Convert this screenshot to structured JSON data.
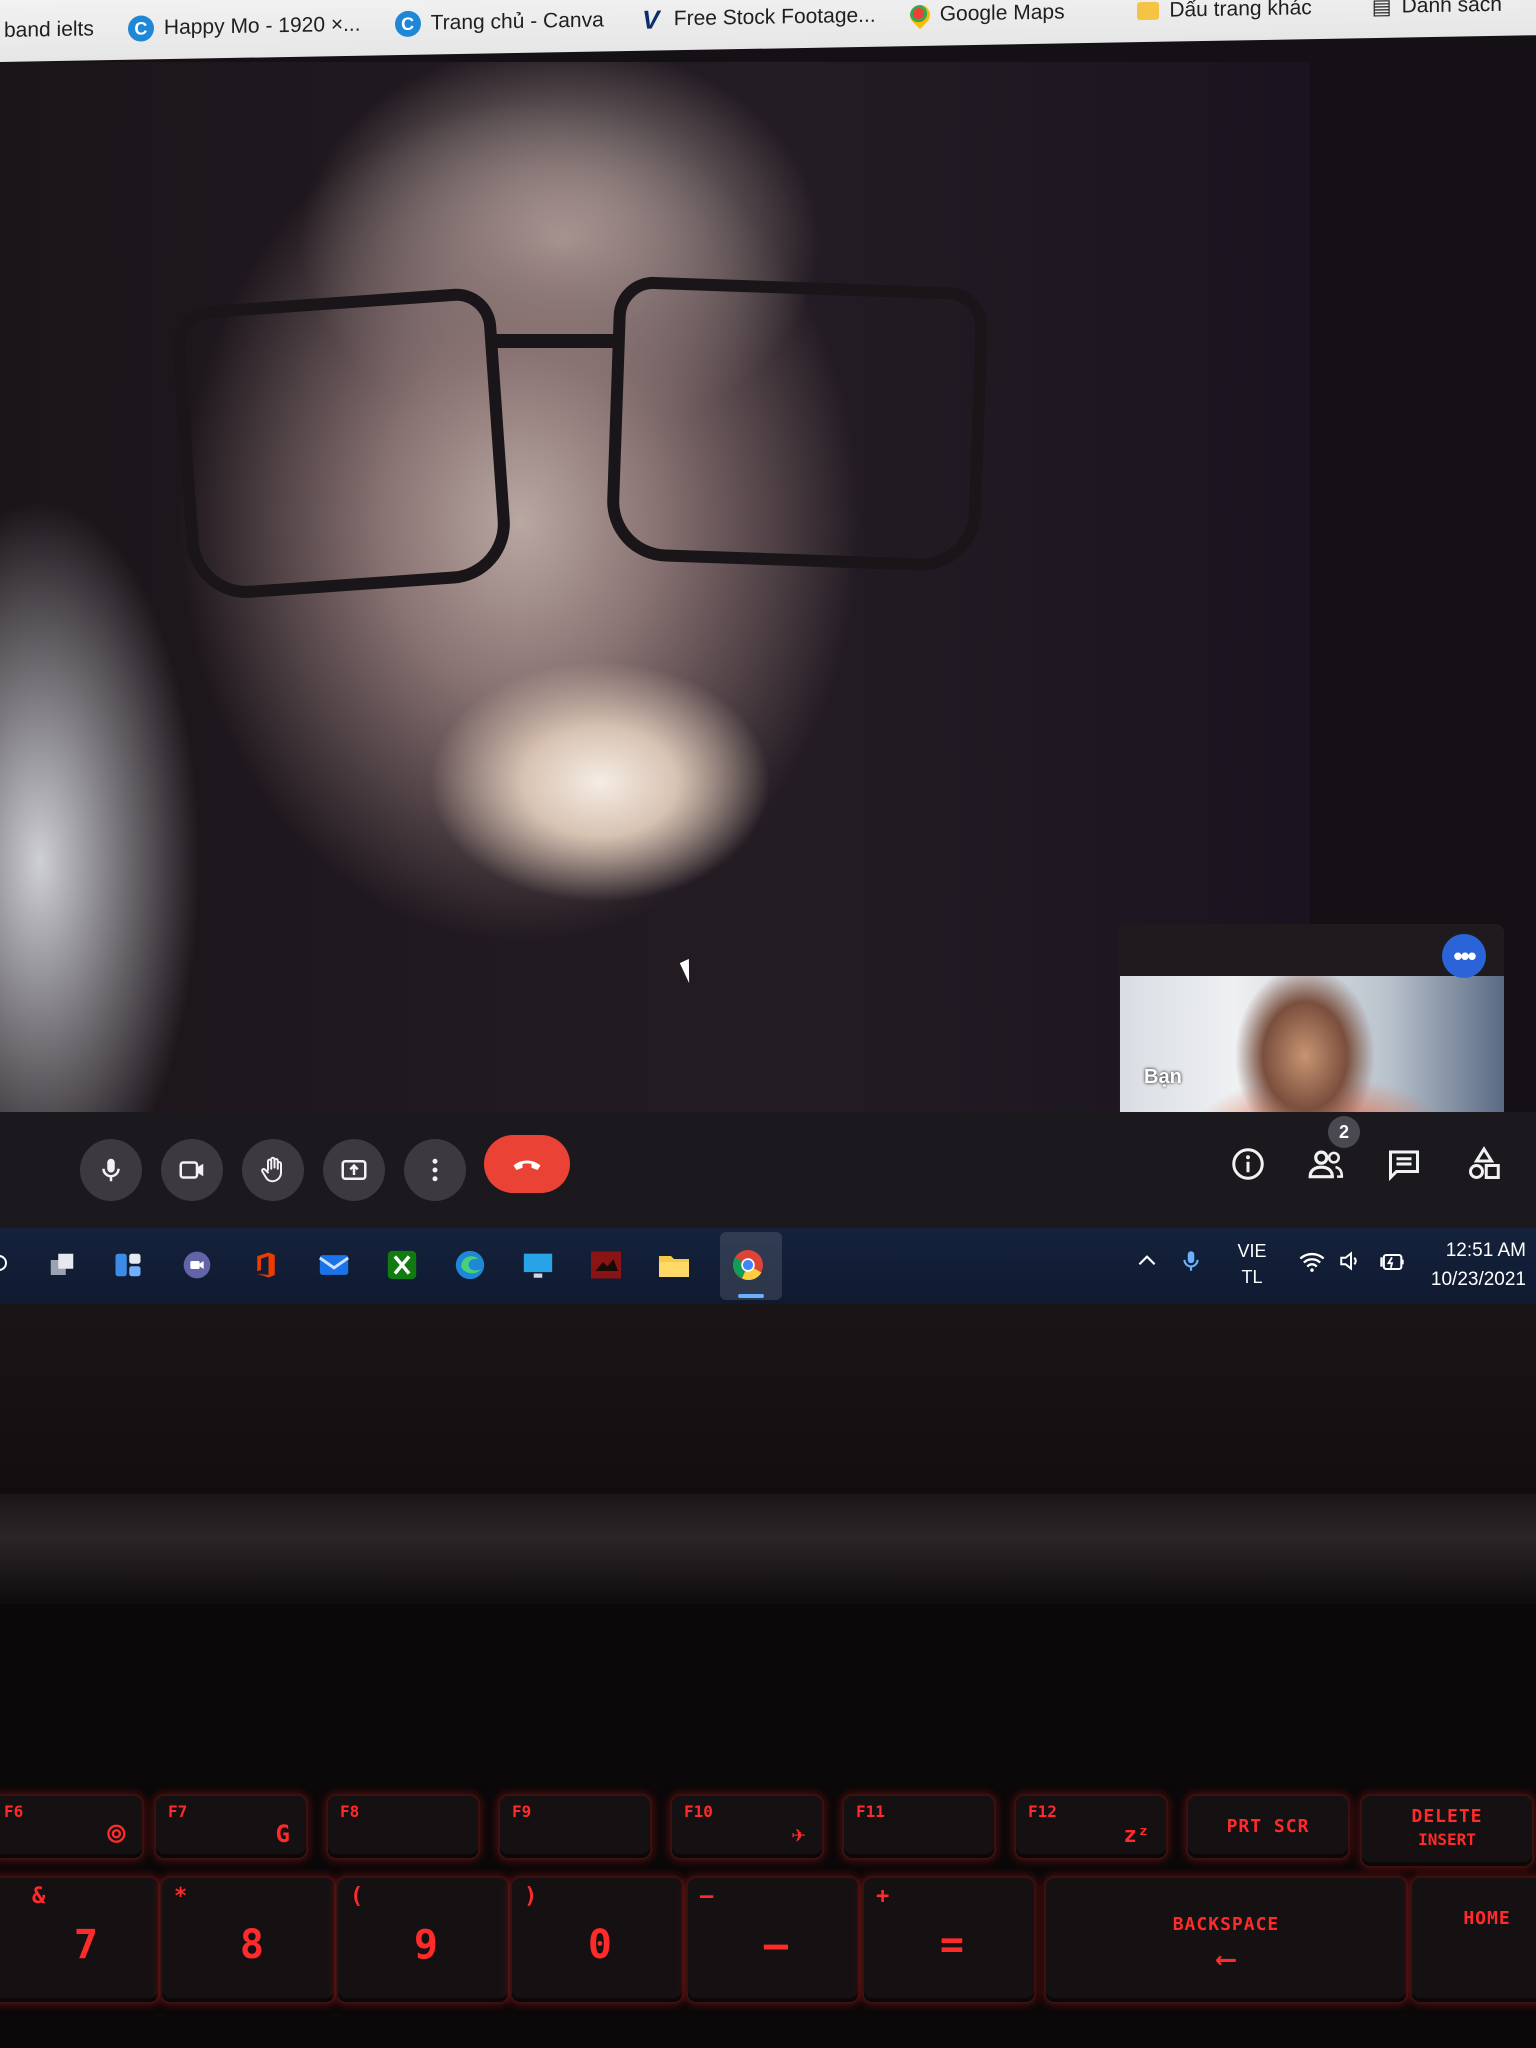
{
  "bookmarks": [
    {
      "label": "band ielts",
      "icon": "none"
    },
    {
      "label": "Happy Mo - 1920 ×...",
      "icon": "canva-icon"
    },
    {
      "label": "Trang chủ - Canva",
      "icon": "canva-icon"
    },
    {
      "label": "Free Stock Footage...",
      "icon": "videvo-icon"
    },
    {
      "label": "Google Maps",
      "icon": "google-maps-icon"
    }
  ],
  "bookmarks_right": {
    "other": "Dấu trang khác",
    "list": "Danh sách"
  },
  "meet": {
    "pip_name": "Bạn",
    "participants_count": "2",
    "controls": [
      "mic-icon",
      "camera-icon",
      "raise-hand-icon",
      "present-icon",
      "more-vert-icon",
      "end-call-icon"
    ],
    "right_controls": [
      "info-icon",
      "people-icon",
      "chat-icon",
      "activities-icon"
    ],
    "end_call_color": "#ea4335"
  },
  "taskbar": {
    "lang_top": "VIE",
    "lang_bottom": "TL",
    "time": "12:51 AM",
    "date": "10/23/2021"
  },
  "keyboard": {
    "fn_row": [
      {
        "top": "F6"
      },
      {
        "top": "F7"
      },
      {
        "top": "F8"
      },
      {
        "top": "F9"
      },
      {
        "top": "F10"
      },
      {
        "top": "F11"
      },
      {
        "top": "F12"
      },
      {
        "label": "PRT SCR"
      },
      {
        "label": "DELETE",
        "sub": "INSERT"
      }
    ],
    "num_row": [
      {
        "top": "&",
        "main": "7"
      },
      {
        "top": "*",
        "main": "8"
      },
      {
        "top": "(",
        "main": "9"
      },
      {
        "top": ")",
        "main": "0"
      },
      {
        "top": "—",
        "main": "–"
      },
      {
        "top": "+",
        "main": "="
      },
      {
        "label": "BACKSPACE",
        "sub": "⟵"
      },
      {
        "label": "HOME"
      }
    ],
    "accent_color": "#ff2a2a"
  }
}
